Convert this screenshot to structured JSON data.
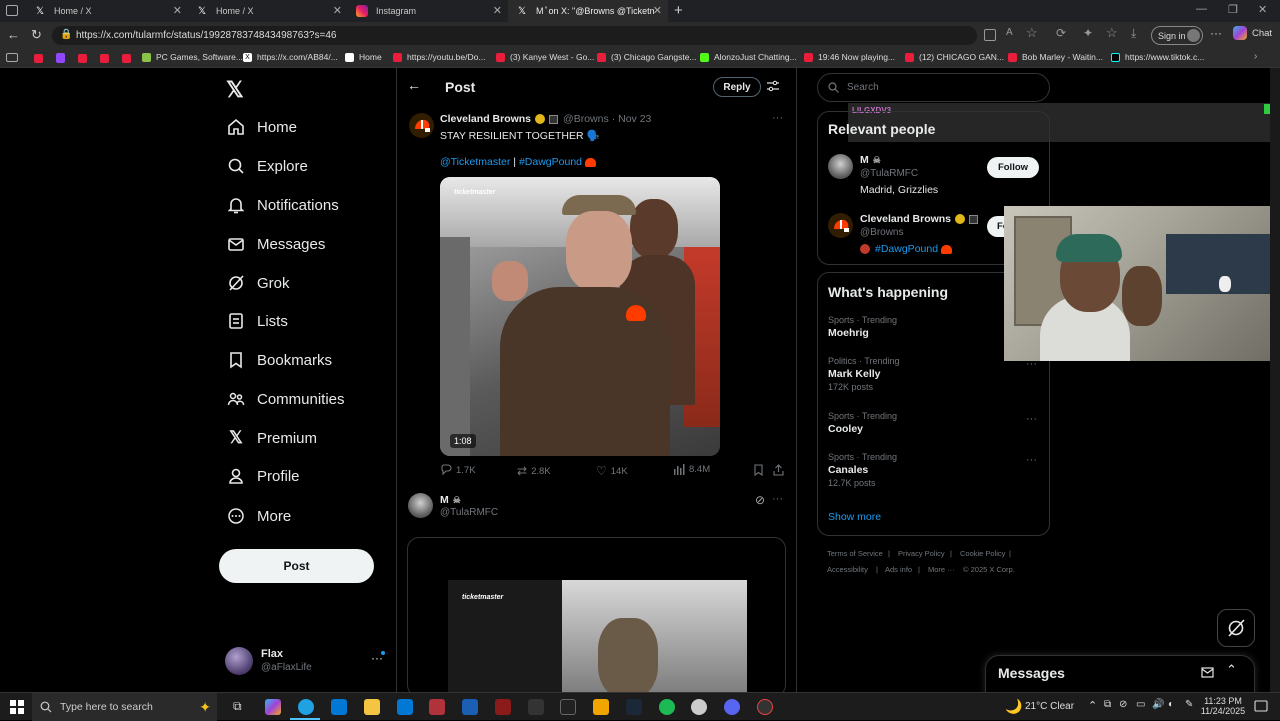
{
  "browser": {
    "tabs": [
      {
        "title": "Home / X"
      },
      {
        "title": "Home / X"
      },
      {
        "title": "Instagram"
      },
      {
        "title": "M  ̊ on X: \"@Browns @Ticketm..."
      }
    ],
    "url": "https://x.com/tularmfc/status/1992878374843498763?s=46",
    "sign_in": "Sign in",
    "chat": "Chat",
    "bookmarks": [
      "PC Games, Software...",
      "https://x.com/AB84/...",
      "Home",
      "https://youtu.be/Do...",
      "(3) Kanye West - Go...",
      "(3) Chicago Gangste...",
      "AlonzoJust Chatting...",
      "19:46 Now playing...",
      "(12) CHICAGO GAN...",
      "Bob Marley - Waitin...",
      "https://www.tiktok.c..."
    ]
  },
  "sidebar": {
    "items": [
      {
        "label": "Home"
      },
      {
        "label": "Explore"
      },
      {
        "label": "Notifications"
      },
      {
        "label": "Messages"
      },
      {
        "label": "Grok"
      },
      {
        "label": "Lists"
      },
      {
        "label": "Bookmarks"
      },
      {
        "label": "Communities"
      },
      {
        "label": "Premium"
      },
      {
        "label": "Profile"
      },
      {
        "label": "More"
      }
    ],
    "post_button": "Post",
    "account": {
      "name": "Flax",
      "handle": "@aFlaxLife"
    }
  },
  "main": {
    "header_title": "Post",
    "reply_button": "Reply",
    "tweet": {
      "author": "Cleveland Browns",
      "handle": "@Browns",
      "date": "· Nov 23",
      "text": "STAY RESILIENT TOGETHER 🗣️",
      "link1": "@Ticketmaster",
      "separator": "|",
      "link2": "#DawgPound",
      "video_watermark": "ticketmaster",
      "video_duration": "1:08",
      "replies": "1.7K",
      "reposts": "2.8K",
      "likes": "14K",
      "views": "8.4M"
    },
    "reply": {
      "author": "M",
      "handle": "@TulaRMFC",
      "video_watermark": "ticketmaster"
    }
  },
  "right": {
    "search_placeholder": "Search",
    "relevant_title": "Relevant people",
    "overlay_user": "LILGXDV3",
    "people": [
      {
        "name": "M",
        "handle": "@TulaRMFC",
        "bio": "Madrid, Grizzlies",
        "button": "Follow"
      },
      {
        "name": "Cleveland Browns",
        "handle": "@Browns",
        "bio": "#DawgPound",
        "button": "Fo"
      }
    ],
    "happening_title": "What's happening",
    "trends": [
      {
        "category": "Sports · Trending",
        "name": "Moehrig",
        "posts": ""
      },
      {
        "category": "Politics · Trending",
        "name": "Mark Kelly",
        "posts": "172K posts"
      },
      {
        "category": "Sports · Trending",
        "name": "Cooley",
        "posts": ""
      },
      {
        "category": "Sports · Trending",
        "name": "Canales",
        "posts": "12.7K posts"
      }
    ],
    "show_more": "Show more",
    "footer": [
      "Terms of Service",
      "Privacy Policy",
      "Cookie Policy",
      "Accessibility",
      "Ads info",
      "More ···",
      "© 2025 X Corp."
    ],
    "messages_title": "Messages"
  },
  "taskbar": {
    "search_placeholder": "Type here to search",
    "weather": "21°C  Clear",
    "time": "11:23 PM",
    "date": "11/24/2025"
  },
  "colors": {
    "accent": "#1d9bf0",
    "browns_orange": "#ff3c00",
    "browns_brown": "#311d00"
  }
}
